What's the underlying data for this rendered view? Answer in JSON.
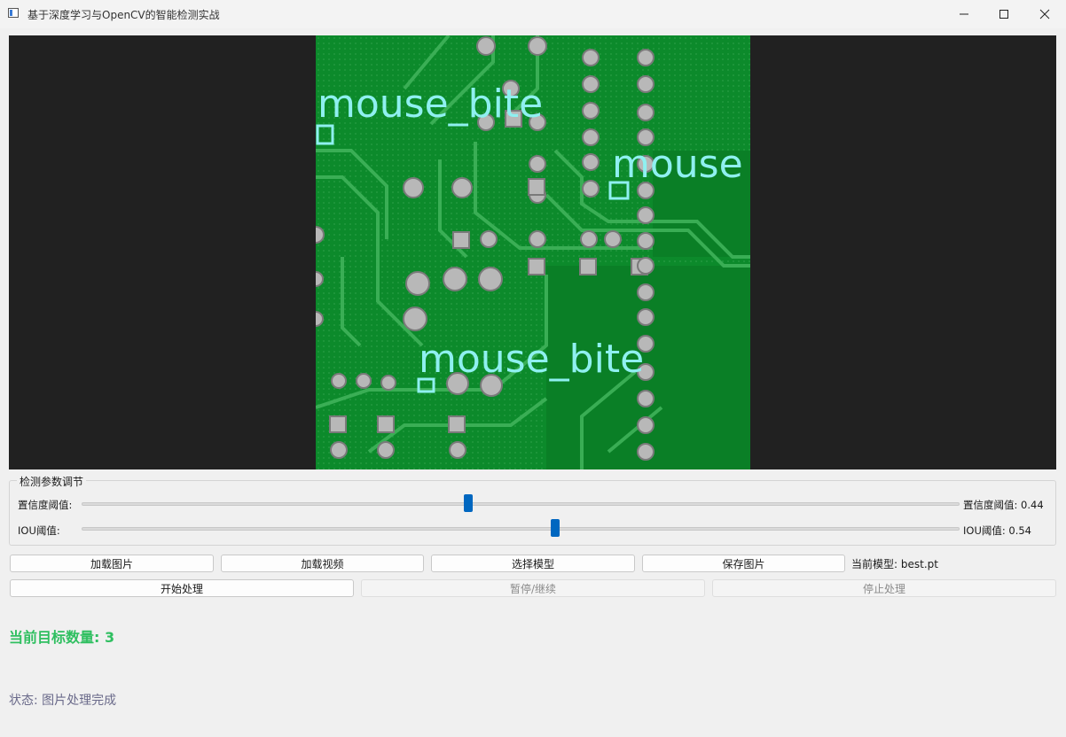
{
  "window": {
    "title": "基于深度学习与OpenCV的智能检测实战",
    "icon": "app-window-icon"
  },
  "detections": [
    {
      "label": "mouse_bite"
    },
    {
      "label": "mouse"
    },
    {
      "label": "mouse_bite"
    }
  ],
  "params": {
    "group_title": "检测参数调节",
    "confidence": {
      "label": "置信度阈值:",
      "value_text": "置信度阈值: 0.44",
      "value": 0.44
    },
    "iou": {
      "label": "IOU阈值:",
      "value_text": "IOU阈值: 0.54",
      "value": 0.54
    }
  },
  "buttons": {
    "load_image": "加载图片",
    "load_video": "加载视频",
    "select_model": "选择模型",
    "save_image": "保存图片",
    "start": "开始处理",
    "pause": "暂停/继续",
    "stop": "停止处理"
  },
  "model": {
    "label": "当前模型: best.pt"
  },
  "count": {
    "label": "当前目标数量: 3"
  },
  "status": {
    "label": "状态: 图片处理完成"
  },
  "colors": {
    "accent": "#0067c0",
    "count": "#2fbf60",
    "pcb": "#0d8a2a",
    "box": "#8ff0f0"
  }
}
